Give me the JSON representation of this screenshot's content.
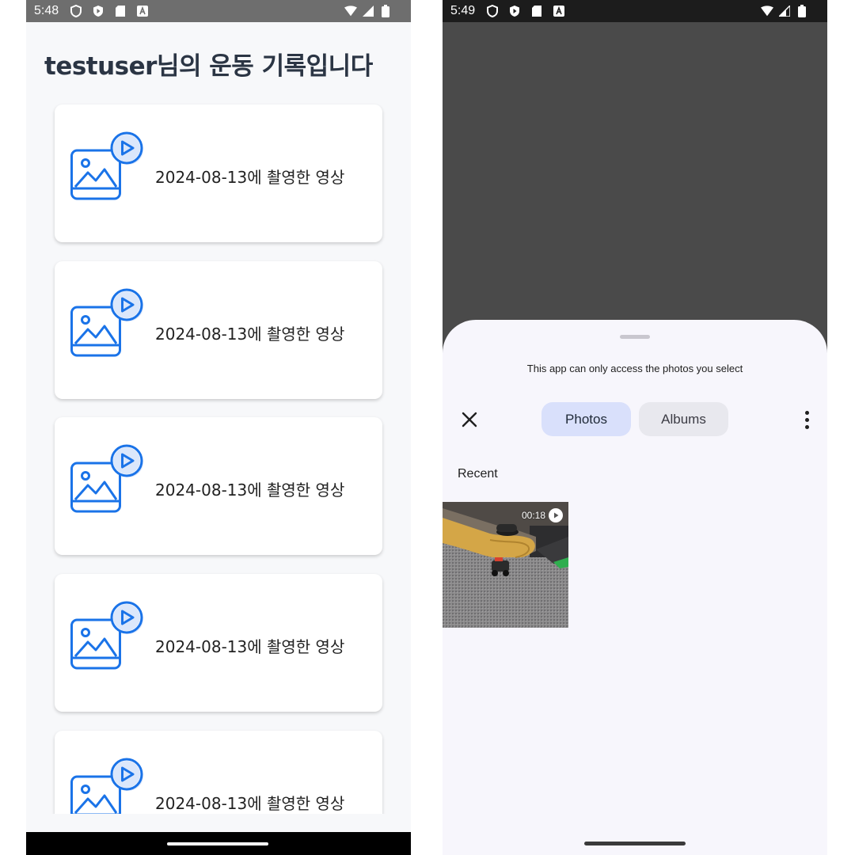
{
  "left_screen": {
    "status_bar": {
      "time": "5:48"
    },
    "title": "testuser님의 운동 기록입니다",
    "records": [
      {
        "label": "2024-08-13에 촬영한 영상"
      },
      {
        "label": "2024-08-13에 촬영한 영상"
      },
      {
        "label": "2024-08-13에 촬영한 영상"
      },
      {
        "label": "2024-08-13에 촬영한 영상"
      },
      {
        "label": "2024-08-13에 촬영한 영상"
      }
    ],
    "icon": "video-file-icon",
    "accent_color": "#1a73e8"
  },
  "right_screen": {
    "status_bar": {
      "time": "5:49"
    },
    "picker": {
      "notice": "This app can only access the photos you select",
      "tabs": {
        "photos": "Photos",
        "albums": "Albums"
      },
      "selected_tab": "Photos",
      "section_heading": "Recent",
      "items": [
        {
          "duration": "00:18",
          "type": "video"
        }
      ]
    }
  }
}
